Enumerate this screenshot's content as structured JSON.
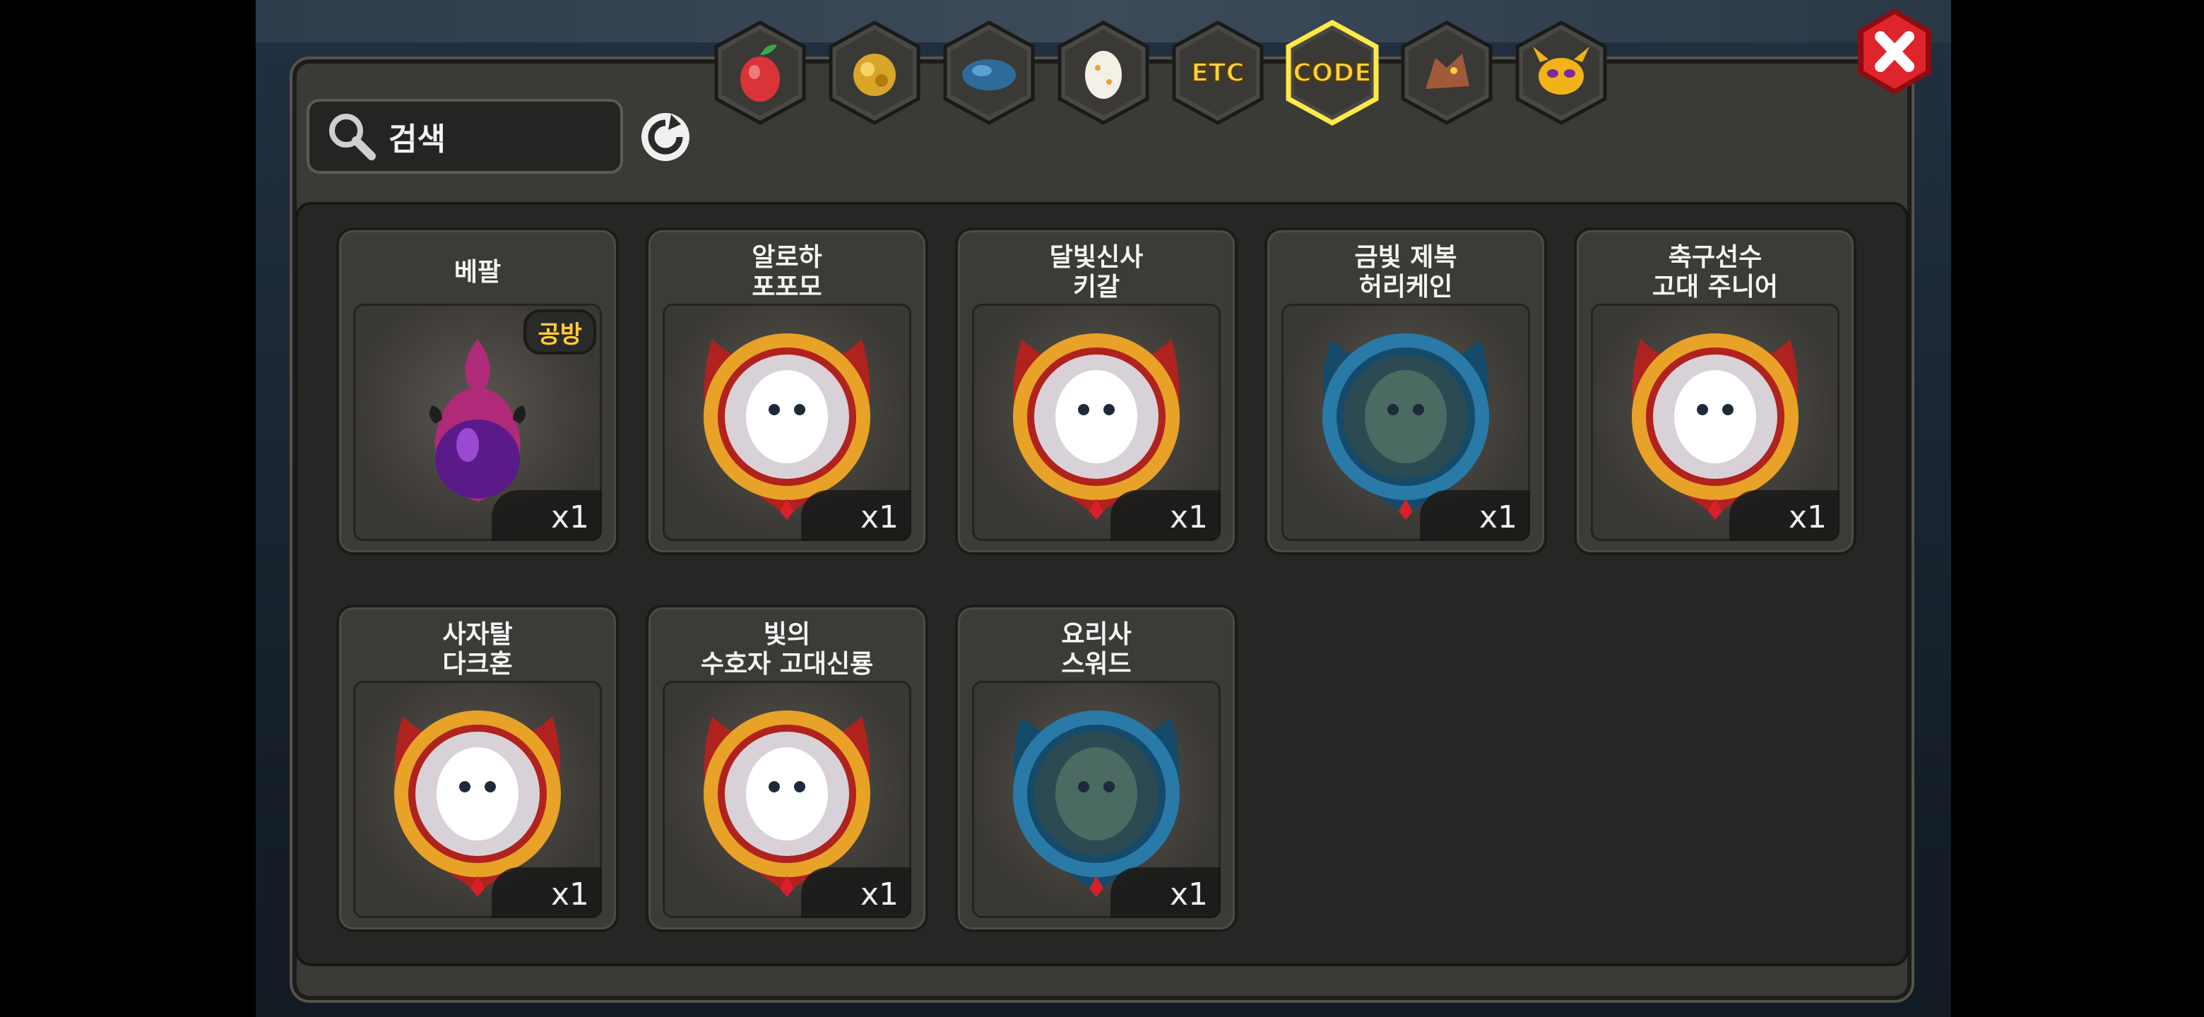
{
  "search": {
    "placeholder": "검색"
  },
  "tabs": [
    {
      "name": "fruit-tab",
      "icon": "fruit-icon"
    },
    {
      "name": "gold-tab",
      "icon": "gold-nugget-icon"
    },
    {
      "name": "creature-tab",
      "icon": "blue-creature-icon"
    },
    {
      "name": "egg-tab",
      "icon": "egg-icon"
    },
    {
      "name": "etc-tab",
      "label": "ETC"
    },
    {
      "name": "code-tab",
      "label": "CODE",
      "selected": true
    },
    {
      "name": "dragon-tab",
      "icon": "dragon-head-icon"
    },
    {
      "name": "mask-tab",
      "icon": "mask-icon"
    }
  ],
  "items": [
    {
      "name": "베팔",
      "qty": "x1",
      "badge": "공방",
      "art": "pink-egg"
    },
    {
      "name": "알로하\n포포모",
      "qty": "x1",
      "art": "gold-medal"
    },
    {
      "name": "달빛신사\n키갈",
      "qty": "x1",
      "art": "gold-medal"
    },
    {
      "name": "금빛 제복\n허리케인",
      "qty": "x1",
      "art": "blue-medal"
    },
    {
      "name": "축구선수\n고대 주니어",
      "qty": "x1",
      "art": "gold-medal"
    },
    {
      "name": "사자탈\n다크혼",
      "qty": "x1",
      "art": "gold-medal"
    },
    {
      "name": "빛의\n수호자 고대신룡",
      "qty": "x1",
      "art": "gold-medal"
    },
    {
      "name": "요리사\n스워드",
      "qty": "x1",
      "art": "blue-medal"
    }
  ],
  "colors": {
    "accent": "#ffd23a",
    "close": "#d81e2a",
    "panel": "#3a3a36"
  }
}
